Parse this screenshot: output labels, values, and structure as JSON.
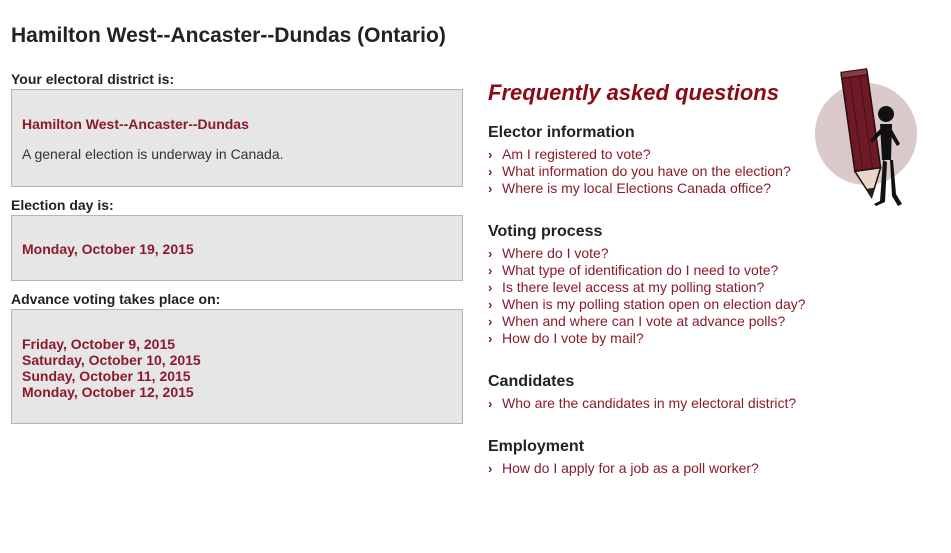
{
  "page": {
    "title": "Hamilton West--Ancaster--Dundas (Ontario)"
  },
  "district": {
    "label": "Your electoral district is:",
    "name": "Hamilton West--Ancaster--Dundas",
    "note": "A general election is underway in Canada."
  },
  "election_day": {
    "label": "Election day is:",
    "date": "Monday, October 19, 2015"
  },
  "advance_voting": {
    "label": "Advance voting takes place on:",
    "dates": [
      "Friday, October 9, 2015",
      "Saturday, October 10, 2015",
      "Sunday, October 11, 2015",
      "Monday, October 12, 2015"
    ]
  },
  "faq": {
    "title": "Frequently asked questions",
    "sections": [
      {
        "heading": "Elector information",
        "links": [
          "Am I registered to vote?",
          "What information do you have on the election?",
          "Where is my local Elections Canada office?"
        ]
      },
      {
        "heading": "Voting process",
        "links": [
          "Where do I vote?",
          "What type of identification do I need to vote?",
          "Is there level access at my polling station?",
          "When is my polling station open on election day?",
          "When and where can I vote at advance polls?",
          "How do I vote by mail?"
        ]
      },
      {
        "heading": "Candidates",
        "links": [
          "Who are the candidates in my electoral district?"
        ]
      },
      {
        "heading": "Employment",
        "links": [
          "How do I apply for a job as a poll worker?"
        ]
      }
    ],
    "bullet_glyph": "›"
  },
  "illustration": {
    "icon": "pencil-person-illustration"
  },
  "colors": {
    "accent": "#8b1a2b",
    "faq_title": "#8b0a14",
    "box_bg": "#e6e6e6",
    "box_border": "#b5b5b5",
    "circle_bg": "#d9c9c9"
  }
}
